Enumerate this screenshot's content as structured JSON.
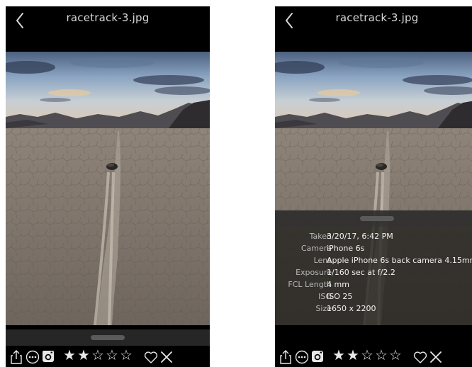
{
  "screens": [
    {
      "title": "racetrack-3.jpg",
      "info_panel_open": false
    },
    {
      "title": "racetrack-3.jpg",
      "info_panel_open": true,
      "info": {
        "taken_label": "Taken",
        "taken_value": "3/20/17, 6:42 PM",
        "camera_label": "Camera",
        "camera_value": "iPhone 6s",
        "lens_label": "Lens",
        "lens_value": "Apple iPhone 6s back camera 4.15mm...",
        "exposure_label": "Exposure",
        "exposure_value": "1/160 sec at f/2.2",
        "fcl_label": "FCL Length",
        "fcl_value": "4 mm",
        "iso_label": "ISO",
        "iso_value": "ISO 25",
        "size_label": "Size",
        "size_value": "1650 x 2200"
      }
    }
  ],
  "toolbar": {
    "icons": [
      "share-icon",
      "more-icon",
      "instagram-icon",
      "heart-icon",
      "close-icon"
    ],
    "rating": 2,
    "rating_max": 5,
    "filled_star": "★",
    "empty_star": "☆"
  },
  "colors": {
    "background": "#000000",
    "drawer": "#262626",
    "handle": "#5a5a5a",
    "text": "#e8e8e8"
  }
}
